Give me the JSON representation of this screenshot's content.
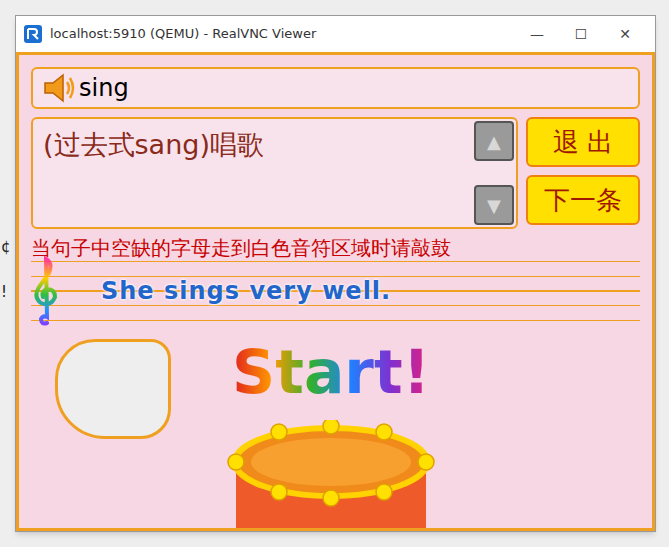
{
  "desktop_edge": [
    "¢",
    "!"
  ],
  "window": {
    "title": "localhost:5910 (QEMU) - RealVNC Viewer",
    "controls": [
      "—",
      "☐",
      "✕"
    ]
  },
  "game": {
    "word": "sing",
    "definition": "(过去式sang)唱歌",
    "scroll": [
      "▲",
      "▼"
    ],
    "buttons": [
      {
        "label": "退 出"
      },
      {
        "label": "下一条"
      }
    ],
    "instruction": "当句子中空缺的字母走到白色音符区域时请敲鼓",
    "sentence": "She sings very well.",
    "banner": "Start!"
  }
}
